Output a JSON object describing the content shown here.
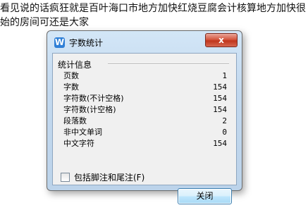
{
  "document": {
    "line1": "看见说的话疯狂就是百叶海口市地方加快红烧豆腐会计核算地方加快很",
    "line2": "始的房间可还是大家"
  },
  "dialog": {
    "title": "字数统计",
    "close_label": "x",
    "group_label": "统计信息",
    "stats": [
      {
        "label": "页数",
        "value": "1"
      },
      {
        "label": "字数",
        "value": "154"
      },
      {
        "label": "字符数(不计空格)",
        "value": "154"
      },
      {
        "label": "字符数(计空格)",
        "value": "154"
      },
      {
        "label": "段落数",
        "value": "2"
      },
      {
        "label": "非中文单词",
        "value": "0"
      },
      {
        "label": "中文字符",
        "value": "154"
      }
    ],
    "checkbox_label": "包括脚注和尾注(F)",
    "checkbox_checked": false,
    "ok_label": "关闭"
  },
  "colors": {
    "title_bar": "#c2d8ee",
    "close_button": "#c0351c",
    "app_icon": "#2f7fd6"
  },
  "icons": {
    "app": "wps-writer-icon",
    "close": "close-icon"
  }
}
